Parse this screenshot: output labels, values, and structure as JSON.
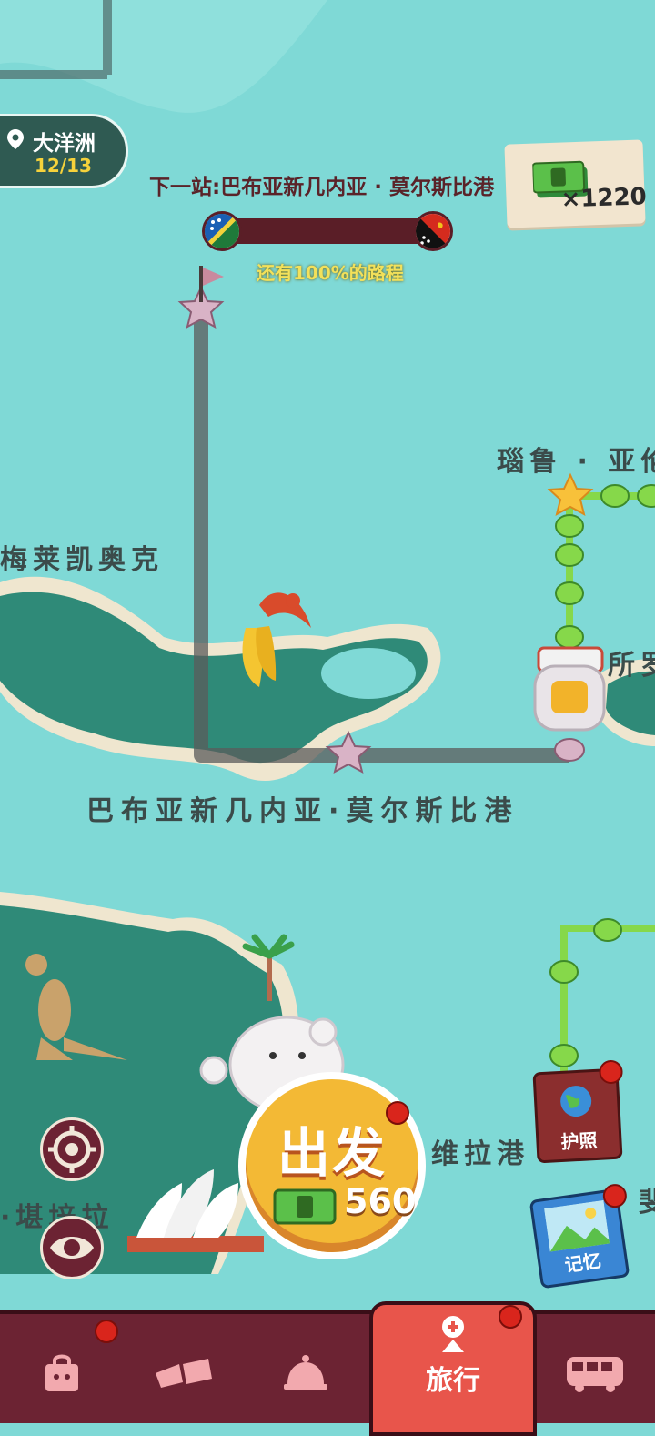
{
  "header": {
    "region_name": "大洋洲",
    "region_progress": "12/13",
    "next_stop": "下一站:巴布亚新几内亚 · 莫尔斯比港",
    "remaining_text": "还有100%的路程",
    "remaining_percent": 100,
    "cash_count": "×1220"
  },
  "map_labels": {
    "rarotonga": "瑙鲁 · 亚伦",
    "melekeok": "梅莱凯奥克",
    "solomon": "所罗",
    "port_moresby": "巴布亚新几内亚·莫尔斯比港",
    "wellington": "维拉港",
    "canberra": "·堪培拉",
    "edge_right": "斐"
  },
  "actions": {
    "go_label": "出发",
    "go_cost": "560",
    "passport_label": "护照",
    "memory_label": "记忆"
  },
  "nav": {
    "active_label": "旅行",
    "items": [
      "shop-bag-icon",
      "plane-tickets-icon",
      "service-bell-icon",
      "travel-icon",
      "bus-icon"
    ]
  },
  "colors": {
    "sea": "#7fd9d6",
    "land": "#2f8a78",
    "sand": "#efe6cf",
    "nav_bg": "#6c2333",
    "nav_active": "#e8554b",
    "route_done": "#86d84a",
    "route_pending": "#5a5a5a"
  }
}
